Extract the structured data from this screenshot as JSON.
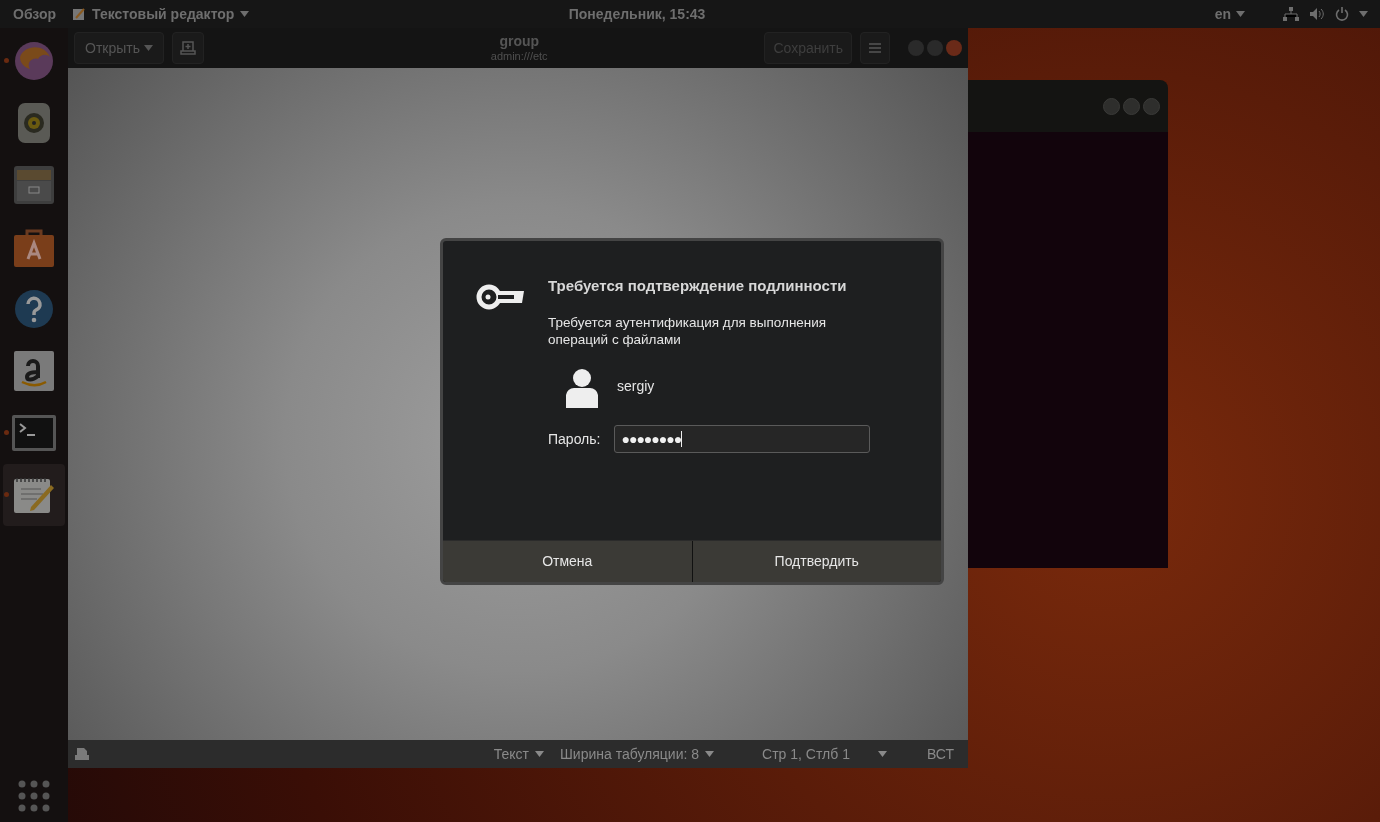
{
  "top_bar": {
    "activities": "Обзор",
    "app_menu": "Текстовый редактор",
    "clock": "Понедельник, 15:43",
    "keyboard_layout": "en"
  },
  "dock": {
    "items": [
      {
        "kind": "browser",
        "running": true,
        "selected": false
      },
      {
        "kind": "music",
        "running": false,
        "selected": false
      },
      {
        "kind": "files",
        "running": false,
        "selected": false
      },
      {
        "kind": "software",
        "running": false,
        "selected": false
      },
      {
        "kind": "help",
        "running": false,
        "selected": false
      },
      {
        "kind": "amazon",
        "running": false,
        "selected": false
      },
      {
        "kind": "terminal",
        "running": true,
        "selected": false
      },
      {
        "kind": "editor",
        "running": true,
        "selected": true
      }
    ]
  },
  "editor": {
    "open_button": "Открыть",
    "title": "group",
    "subtitle": "admin:///etc",
    "save_button": "Сохранить",
    "status_bar": {
      "language": "Текст",
      "tab_width": "Ширина табуляции: 8",
      "position": "Стр 1, Стлб 1",
      "mode": "ВСТ"
    }
  },
  "dialog": {
    "title": "Требуется подтверждение подлинности",
    "message": "Требуется аутентификация для выполнения операций с файлами",
    "user": "sergiy",
    "password_label": "Пароль:",
    "password_value": "●●●●●●●●",
    "buttons": [
      "Отмена",
      "Подтвердить"
    ]
  }
}
